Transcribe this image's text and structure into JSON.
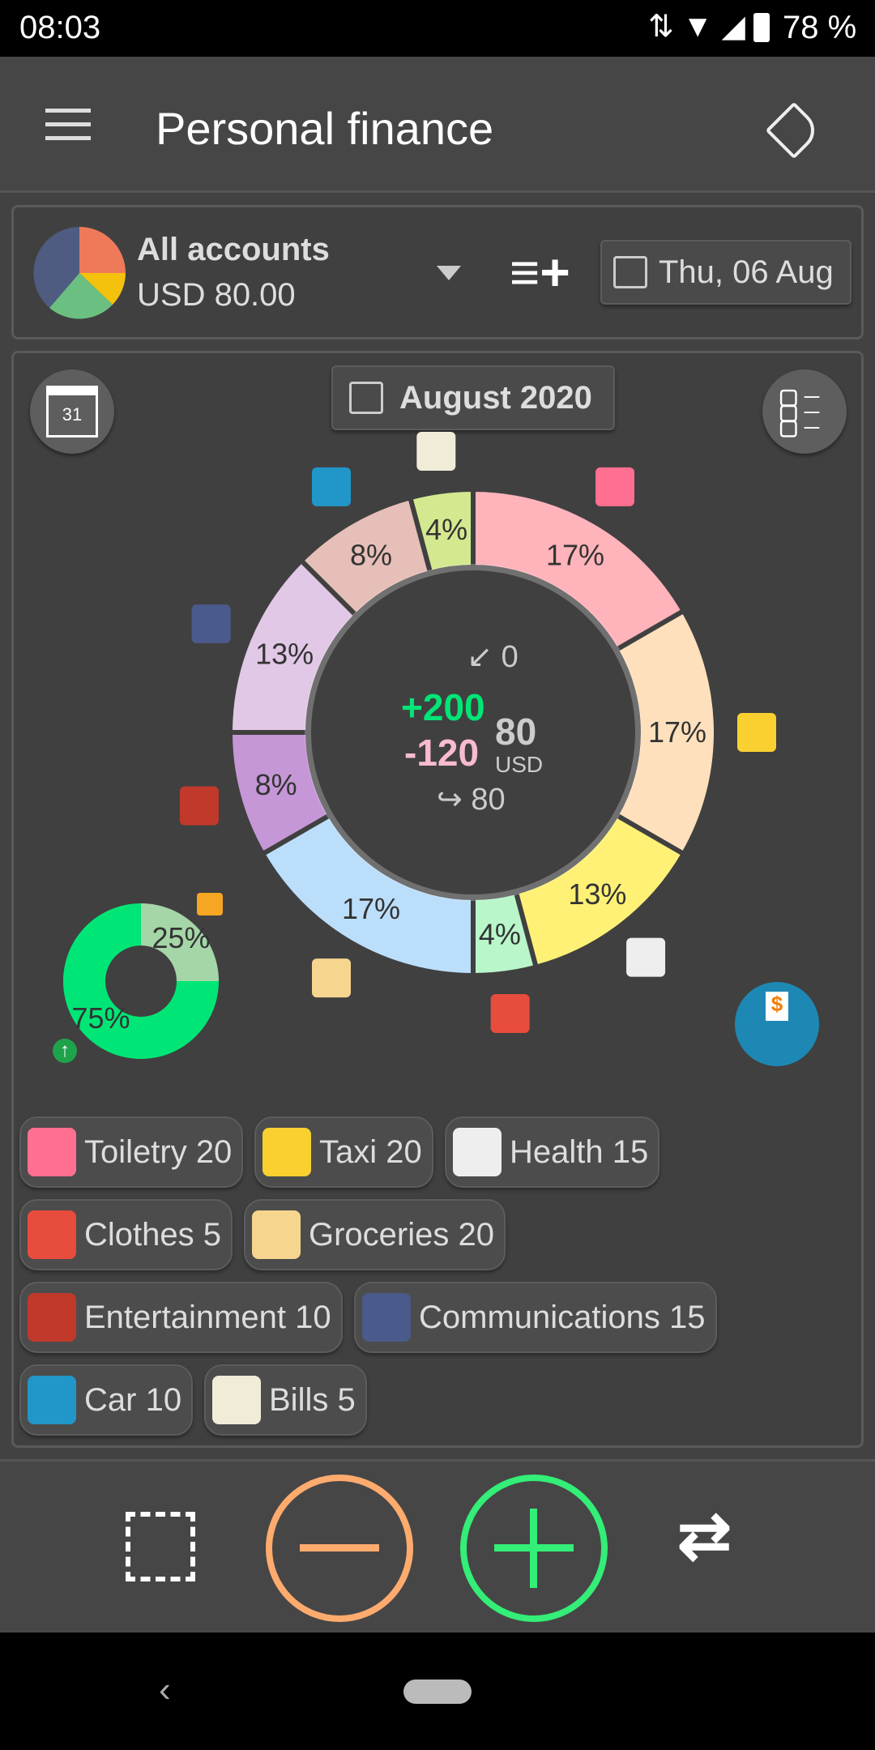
{
  "status": {
    "time": "08:03",
    "battery": "78 %"
  },
  "appbar": {
    "title": "Personal finance"
  },
  "account": {
    "name": "All accounts",
    "balance": "USD 80.00",
    "date": "Thu, 06 Aug"
  },
  "period": {
    "label": "August 2020",
    "calendar_day": "31"
  },
  "summary": {
    "transfer_in": "0",
    "income": "+200",
    "expense": "-120",
    "total": "80",
    "currency": "USD",
    "transfer_out": "80"
  },
  "colors": {
    "income": "#00e676",
    "expense": "#f8bbd0",
    "minus_button": "#ffab6e",
    "plus_button": "#33ee77"
  },
  "chart_data": [
    {
      "type": "pie",
      "title": "",
      "slices": [
        {
          "label": "Toiletry",
          "value": 20,
          "percent": "17%",
          "color": "#ffb3ba",
          "icon": "toiletry-icon"
        },
        {
          "label": "Taxi",
          "value": 20,
          "percent": "17%",
          "color": "#ffe0bd",
          "icon": "taxi-icon"
        },
        {
          "label": "Health",
          "value": 15,
          "percent": "13%",
          "color": "#fff176",
          "icon": "first-aid-icon"
        },
        {
          "label": "Clothes",
          "value": 5,
          "percent": "4%",
          "color": "#b9f6ca",
          "icon": "tshirt-icon"
        },
        {
          "label": "Groceries",
          "value": 20,
          "percent": "17%",
          "color": "#bbdefb",
          "icon": "grocery-bag-icon"
        },
        {
          "label": "Entertainment",
          "value": 10,
          "percent": "8%",
          "color": "#c597d6",
          "icon": "cocktail-icon"
        },
        {
          "label": "Communications",
          "value": 15,
          "percent": "13%",
          "color": "#e1c8e6",
          "icon": "phone-icon"
        },
        {
          "label": "Car",
          "value": 10,
          "percent": "8%",
          "color": "#e6bfb8",
          "icon": "car-icon"
        },
        {
          "label": "Bills",
          "value": 5,
          "percent": "4%",
          "color": "#d4e98f",
          "icon": "receipt-icon"
        }
      ]
    },
    {
      "type": "pie",
      "title": "",
      "slices": [
        {
          "label": "",
          "value": 25,
          "percent": "25%",
          "color": "#a5d6a7"
        },
        {
          "label": "",
          "value": 75,
          "percent": "75%",
          "color": "#00e676"
        }
      ]
    }
  ],
  "chips": [
    {
      "label": "Toiletry 20",
      "color": "#ff6f91"
    },
    {
      "label": "Taxi 20",
      "color": "#f9d030"
    },
    {
      "label": "Health 15",
      "color": "#eeeeee"
    },
    {
      "label": "Clothes 5",
      "color": "#e84c3d"
    },
    {
      "label": "Groceries 20",
      "color": "#f6d58e"
    },
    {
      "label": "Entertainment 10",
      "color": "#c0392b"
    },
    {
      "label": "Communications 15",
      "color": "#4a5a8a"
    },
    {
      "label": "Car 10",
      "color": "#2196c8"
    },
    {
      "label": "Bills 5",
      "color": "#f0ecd8"
    }
  ]
}
